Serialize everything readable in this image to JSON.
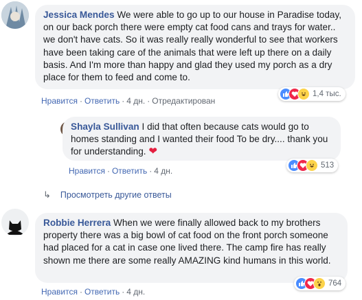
{
  "comments": [
    {
      "author": "Jessica Mendes",
      "text": "We were able to go up to our house in Paradise today, on our back porch there were empty cat food cans and trays for water.. we don't have cats. So it was really really wonderful to see that workers have been taking care of the animals that were left up there on a daily basis. And I'm more than happy and glad they used my porch as a dry place for them to feed and come to.",
      "actions": {
        "like": "Нравится",
        "reply": "Ответить",
        "time": "4 дн.",
        "edited": "Отредактирован"
      },
      "reactions": {
        "icons": [
          "like-icon",
          "love-icon",
          "haha-icon"
        ],
        "count": "1,4 тыс."
      }
    },
    {
      "author": "Shayla Sullivan",
      "text": "I did that often because cats would go to homes standing and I wanted their food To be dry.... thank you for understanding.",
      "emoji": "❤",
      "actions": {
        "like": "Нравится",
        "reply": "Ответить",
        "time": "4 дн."
      },
      "reactions": {
        "icons": [
          "like-icon",
          "love-icon",
          "haha-icon"
        ],
        "count": "513"
      }
    },
    {
      "author": "Robbie Herrera",
      "text": "When we were finally allowed back to my brothers property there was a big bowl of cat food on the front porch someone had placed for a cat in case one lived there. The camp fire has really shown me there are some really AMAZING kind humans in this world.",
      "actions": {
        "like": "Нравится",
        "reply": "Ответить",
        "time": "4 дн."
      },
      "reactions": {
        "icons": [
          "like-icon",
          "love-icon",
          "wow-icon"
        ],
        "count": "764"
      }
    }
  ],
  "more_replies": {
    "icon": "reply-arrow-icon",
    "label": "Просмотреть другие ответы"
  },
  "colors": {
    "author": "#385898",
    "link": "#4267b2",
    "meta": "#606770",
    "bubble": "#f2f3f5",
    "heart": "#e41e3f"
  }
}
